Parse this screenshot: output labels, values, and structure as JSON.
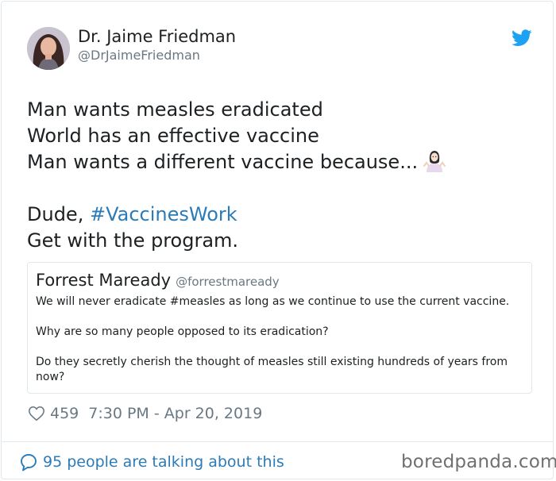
{
  "author": {
    "name": "Dr. Jaime Friedman",
    "handle": "@DrJaimeFriedman"
  },
  "tweet": {
    "line1": "Man wants measles eradicated",
    "line2": "World has an effective vaccine",
    "line3": "Man wants a different vaccine because...",
    "line5_prefix": "Dude, ",
    "hashtag": "#VaccinesWork",
    "line6": "Get with the program."
  },
  "quoted": {
    "name": "Forrest Maready",
    "handle": "@forrestmaready",
    "para1": "We will never eradicate #measles as long as we continue to use the current vaccine.",
    "para2": "Why are so many people opposed to its eradication?",
    "para3": "Do they secretly cherish the thought of measles still existing hundreds of years from now?"
  },
  "meta": {
    "likes": "459",
    "timestamp": "7:30 PM - Apr 20, 2019"
  },
  "footer": {
    "talking": "95 people are talking about this",
    "watermark": "boredpanda.com"
  },
  "icons": {
    "brand": "twitter-bird-icon",
    "emoji": "woman-shrugging-icon",
    "like": "heart-icon",
    "comment": "speech-bubble-icon"
  },
  "colors": {
    "link": "#2b7bb9",
    "twitter_blue": "#1da1f2",
    "muted": "#697882",
    "text": "#1c2022"
  }
}
